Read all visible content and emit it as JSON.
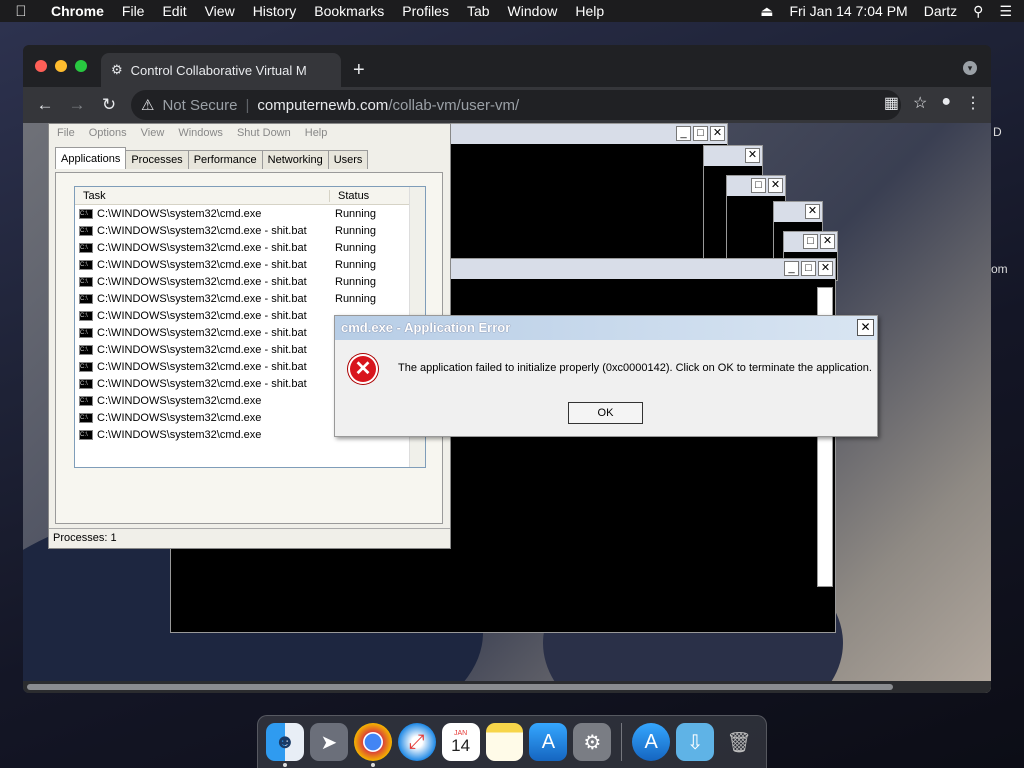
{
  "menubar": {
    "app": "Chrome",
    "items": [
      "File",
      "Edit",
      "View",
      "History",
      "Bookmarks",
      "Profiles",
      "Tab",
      "Window",
      "Help"
    ],
    "datetime": "Fri Jan 14  7:04 PM",
    "user": "Dartz"
  },
  "browser": {
    "tab_title": "Control Collaborative Virtual M",
    "security": "Not Secure",
    "url_host": "computernewb.com",
    "url_path": "/collab-vm/user-vm/"
  },
  "taskmgr": {
    "menu": [
      "File",
      "Options",
      "View",
      "Windows",
      "Shut Down",
      "Help"
    ],
    "tabs": [
      "Applications",
      "Processes",
      "Performance",
      "Networking",
      "Users"
    ],
    "col_task": "Task",
    "col_status": "Status",
    "rows": [
      {
        "task": "C:\\WINDOWS\\system32\\cmd.exe",
        "status": "Running"
      },
      {
        "task": "C:\\WINDOWS\\system32\\cmd.exe - shit.bat",
        "status": "Running"
      },
      {
        "task": "C:\\WINDOWS\\system32\\cmd.exe - shit.bat",
        "status": "Running"
      },
      {
        "task": "C:\\WINDOWS\\system32\\cmd.exe - shit.bat",
        "status": "Running"
      },
      {
        "task": "C:\\WINDOWS\\system32\\cmd.exe - shit.bat",
        "status": "Running"
      },
      {
        "task": "C:\\WINDOWS\\system32\\cmd.exe - shit.bat",
        "status": "Running"
      },
      {
        "task": "C:\\WINDOWS\\system32\\cmd.exe - shit.bat",
        "status": ""
      },
      {
        "task": "C:\\WINDOWS\\system32\\cmd.exe - shit.bat",
        "status": ""
      },
      {
        "task": "C:\\WINDOWS\\system32\\cmd.exe - shit.bat",
        "status": ""
      },
      {
        "task": "C:\\WINDOWS\\system32\\cmd.exe - shit.bat",
        "status": ""
      },
      {
        "task": "C:\\WINDOWS\\system32\\cmd.exe - shit.bat",
        "status": ""
      },
      {
        "task": "C:\\WINDOWS\\system32\\cmd.exe",
        "status": ""
      },
      {
        "task": "C:\\WINDOWS\\system32\\cmd.exe",
        "status": ""
      },
      {
        "task": "C:\\WINDOWS\\system32\\cmd.exe",
        "status": ""
      }
    ],
    "status_bar": "Processes: 1"
  },
  "error": {
    "title": "cmd.exe - Application Error",
    "message": "The application failed to initialize properly (0xc0000142). Click on OK to terminate the application.",
    "ok": "OK"
  },
  "icons": {
    "error": "error-icon",
    "close": "close-icon"
  },
  "dock": [
    "finder-icon",
    "launchpad-icon",
    "chrome-icon",
    "safari-icon",
    "calendar-icon",
    "notes-icon",
    "app-store-icon",
    "system-preferences-icon",
    "app-store-icon",
    "downloads-folder-icon",
    "trash-icon"
  ],
  "calendar_day": "14",
  "calendar_month": "JAN",
  "edge_text": {
    "a": "D",
    "b": "om"
  }
}
